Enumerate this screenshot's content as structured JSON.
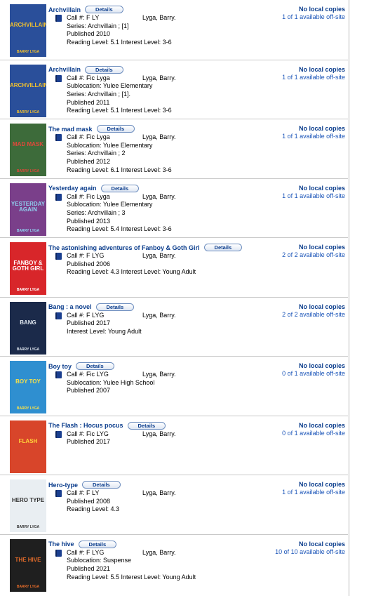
{
  "labels": {
    "details": "Details",
    "call_prefix": "Call #:",
    "no_local": "No local copies"
  },
  "results": [
    {
      "title": "Archvillain",
      "call_number": "F LY",
      "author": "Lyga, Barry.",
      "info": [
        "Series: Archvillain ; [1]",
        "Published 2010",
        "Reading Level: 5.1  Interest Level: 3-6"
      ],
      "availability": "1 of 1 available off-site",
      "cover": {
        "bg": "#2a4f9a",
        "text": "ARCHVILLAIN",
        "author_text": "BARRY LYGA",
        "fg": "#f2c12e"
      }
    },
    {
      "title": "Archvillain",
      "call_number": "Fic Lyga",
      "author": "Lyga, Barry.",
      "info": [
        "Sublocation: Yulee Elementary",
        "Series: Archvillain ; [1].",
        "Published 2011",
        "Reading Level: 5.1  Interest Level: 3-6"
      ],
      "availability": "1 of 1 available off-site",
      "cover": {
        "bg": "#2a4f9a",
        "text": "ARCHVILLAIN",
        "author_text": "BARRY LYGA",
        "fg": "#f2c12e"
      }
    },
    {
      "title": "The mad mask",
      "call_number": "Fic Lyga",
      "author": "Lyga, Barry.",
      "info": [
        "Sublocation: Yulee Elementary",
        "Series: Archvillain ; 2",
        "Published 2012",
        "Reading Level: 6.1  Interest Level: 3-6"
      ],
      "availability": "1 of 1 available off-site",
      "cover": {
        "bg": "#3d6b3a",
        "text": "MAD MASK",
        "author_text": "BARRY LYGA",
        "fg": "#e0483a"
      }
    },
    {
      "title": "Yesterday again",
      "call_number": "Fic Lyga",
      "author": "Lyga, Barry.",
      "info": [
        "Sublocation: Yulee Elementary",
        "Series: Archvillain ; 3",
        "Published 2013",
        "Reading Level: 5.4  Interest Level: 3-6"
      ],
      "availability": "1 of 1 available off-site",
      "cover": {
        "bg": "#7a3f8a",
        "text": "YESTERDAY AGAIN",
        "author_text": "BARRY LYGA",
        "fg": "#8fd0ef"
      }
    },
    {
      "title": "The astonishing adventures of Fanboy & Goth Girl",
      "call_number": "F LYG",
      "author": "Lyga, Barry.",
      "info": [
        "Published 2006",
        "Reading Level: 4.3  Interest Level: Young Adult"
      ],
      "availability": "2 of 2 available off-site",
      "cover": {
        "bg": "#d8262a",
        "text": "FANBOY & GOTH GIRL",
        "author_text": "BARRY LYGA",
        "fg": "#ffffff"
      }
    },
    {
      "title": "Bang : a novel",
      "call_number": "F LYG",
      "author": "Lyga, Barry.",
      "info": [
        "Published 2017",
        "Interest Level: Young Adult"
      ],
      "availability": "2 of 2 available off-site",
      "cover": {
        "bg": "#1b2a4a",
        "text": "BANG",
        "author_text": "BARRY LYGA",
        "fg": "#dfe6ef"
      }
    },
    {
      "title": "Boy toy",
      "call_number": "Fic LYG",
      "author": "Lyga, Barry.",
      "info": [
        "Sublocation: Yulee High School",
        "Published 2007"
      ],
      "availability": "0 of 1 available off-site",
      "cover": {
        "bg": "#2f8fd0",
        "text": "BOY TOY",
        "author_text": "BARRY LYGA",
        "fg": "#f7e04a"
      }
    },
    {
      "title": "The Flash : Hocus pocus",
      "call_number": "Fic LYG",
      "author": "Lyga, Barry.",
      "info": [
        "Published 2017"
      ],
      "availability": "0 of 1 available off-site",
      "cover": {
        "bg": "#d8452a",
        "text": "FLASH",
        "author_text": "",
        "fg": "#ffd23a"
      }
    },
    {
      "title": "Hero-type",
      "call_number": "F LY",
      "author": "Lyga, Barry.",
      "info": [
        "Published 2008",
        "Reading Level: 4.3"
      ],
      "availability": "1 of 1 available off-site",
      "cover": {
        "bg": "#e9eef2",
        "text": "HERO TYPE",
        "author_text": "BARRY LYGA",
        "fg": "#333333"
      }
    },
    {
      "title": "The hive",
      "call_number": "F LYG",
      "author": "Lyga, Barry.",
      "info": [
        "Sublocation: Suspense",
        "Published 2021",
        "Reading Level: 5.5  Interest Level: Young Adult"
      ],
      "availability": "10 of 10 available off-site",
      "cover": {
        "bg": "#1f1f1f",
        "text": "THE HIVE",
        "author_text": "BARRY LYGA",
        "fg": "#e06a2a"
      }
    }
  ]
}
